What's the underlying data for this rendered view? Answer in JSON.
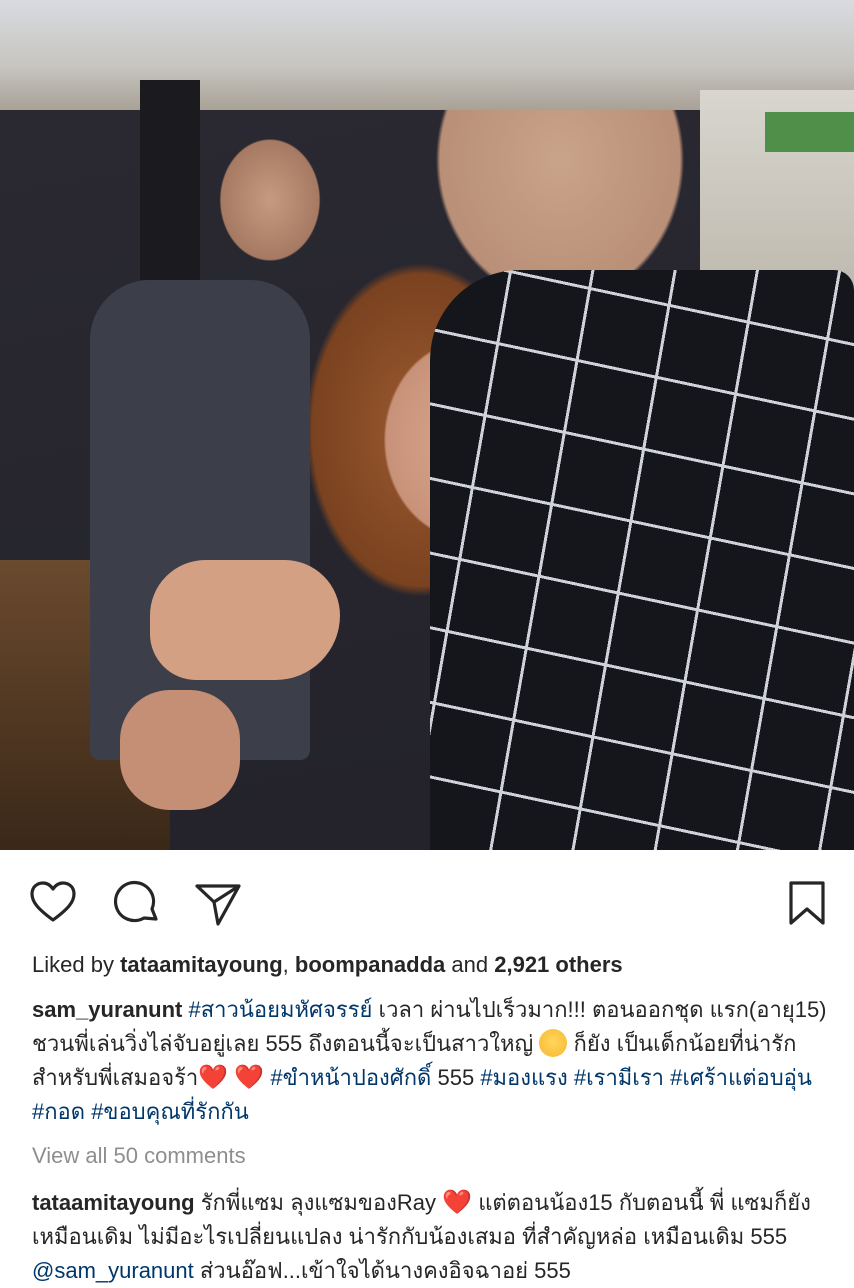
{
  "post": {
    "image_alt_subject": "",
    "likes": {
      "prefix": "Liked by",
      "user1": "tataamitayoung",
      "separator": ",",
      "user2": "boompanadda",
      "middle": "and",
      "others": "2,921 others"
    },
    "caption": {
      "username": "sam_yuranunt",
      "tag1": "#สาวน้อยมหัศจรรย์",
      "text1": "เวลา ผ่านไปเร็วมาก!!! ตอนออกชุด แรก(อายุ15) ชวนพี่เล่นวิ่งไล่จับอยู่เลย 555 ถึงตอนนี้จะเป็นสาวใหญ่",
      "text2": "ก็ยัง เป็นเด็กน้อยที่น่ารักสำหรับพี่เสมอจร้า",
      "tag2": "#ขำหน้าปองศักดิ์",
      "text3": "555",
      "tag3": "#มองแรง",
      "tag4": "#เรามีเรา",
      "tag5": "#เศร้าแต่อบอุ่น",
      "tag6": "#กอด",
      "tag7": "#ขอบคุณที่รักกัน"
    },
    "view_all_comments": "View all 50 comments",
    "comment": {
      "username": "tataamitayoung",
      "text1": "รักพี่แซม ลุงแซมของRay",
      "text2": "แต่ตอนน้อง15 กับตอนนี้ พี่ แซมก็ยังเหมือนเดิม ไม่มีอะไรเปลี่ยนแปลง น่ารักกับน้องเสมอ ที่สำคัญหล่อ เหมือนเดิม 555",
      "mention": "@sam_yuranunt",
      "text3": "ส่วนอ๊อฟ...เข้าใจได้นางคงอิจฉาอย่ 555"
    },
    "heart_glyph": "❤️"
  },
  "icons": {
    "like": "heart-outline-icon",
    "comment": "comment-bubble-icon",
    "share": "paper-plane-icon",
    "save": "bookmark-icon"
  },
  "colors": {
    "link": "#00376b",
    "muted": "#8e8e8e",
    "heart": "#e0173a"
  }
}
